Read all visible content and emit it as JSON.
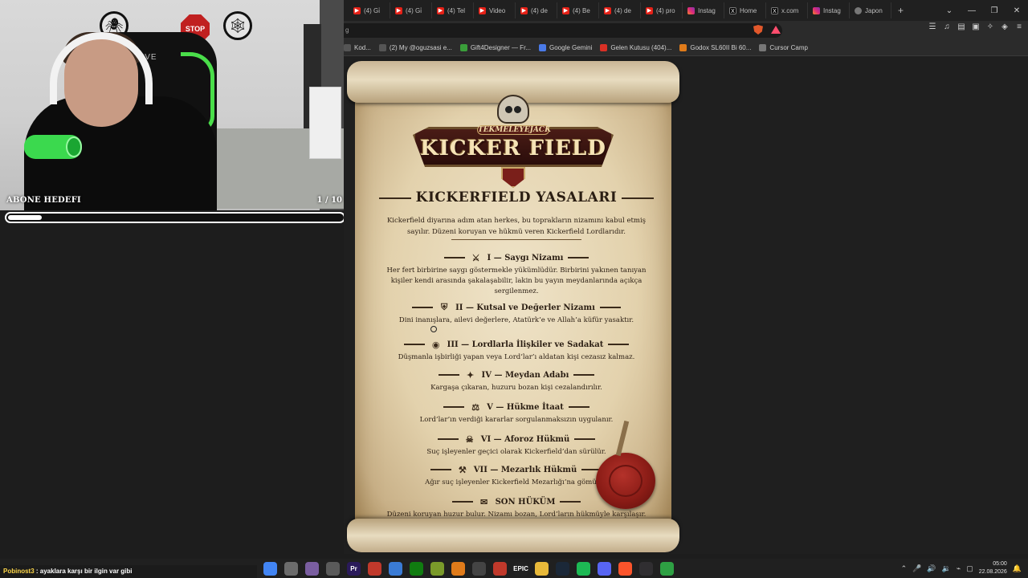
{
  "webcam": {
    "chair_brand": "DRIVE",
    "stop_sticker": "STOP",
    "goal": {
      "title": "ABONE HEDEFI",
      "count": "1 / 10",
      "progress": 0.1
    }
  },
  "browser": {
    "tabs": [
      {
        "label": "(4) Gi̇",
        "kind": "yt"
      },
      {
        "label": "(4) Gi̇",
        "kind": "yt"
      },
      {
        "label": "(4) Tel",
        "kind": "yt"
      },
      {
        "label": "Video",
        "kind": "yt"
      },
      {
        "label": "(4) de",
        "kind": "yt"
      },
      {
        "label": "(4) Be",
        "kind": "yt"
      },
      {
        "label": "(4) de",
        "kind": "yt"
      },
      {
        "label": "(4) pro",
        "kind": "yt"
      },
      {
        "label": "Instag",
        "kind": "ig"
      },
      {
        "label": "Home",
        "kind": "x"
      },
      {
        "label": "x.com",
        "kind": "x"
      },
      {
        "label": "Instag",
        "kind": "ig"
      },
      {
        "label": "Japon",
        "kind": "gray"
      }
    ],
    "new_tab": "+",
    "url": "g",
    "bookmarks": [
      {
        "label": "Kod...",
        "color": "#555"
      },
      {
        "label": "(2) My @oguzsasi e...",
        "color": "#555"
      },
      {
        "label": "Gift4Designer — Fr...",
        "color": "#3a9e3a"
      },
      {
        "label": "Google Gemini",
        "color": "#4a7ae8"
      },
      {
        "label": "Gelen Kutusu (404)...",
        "color": "#d93025"
      },
      {
        "label": "Godox SL60II Bi 60...",
        "color": "#e07b1a"
      },
      {
        "label": "Cursor Camp",
        "color": "#777"
      }
    ]
  },
  "scroll": {
    "logo_small": "TEKMELEYEJACK",
    "logo_big": "KICKER FIELD",
    "title": "KICKERFIELD YASALARI",
    "intro": "Kickerfield diyarına adım atan herkes, bu toprakların nizamını kabul etmiş sayılır. Düzeni koruyan ve hükmü veren Kickerfield Lordlarıdır.",
    "laws": [
      {
        "heading": "I — Saygı Nizamı",
        "emblem": "⚔",
        "body": "Her fert birbirine saygı göstermekle yükümlüdür. Birbirini yakınen tanıyan kişiler kendi arasında şakalaşabilir, lakin bu yayın meydanlarında açıkça sergilenmez."
      },
      {
        "heading": "II — Kutsal ve Değerler Nizamı",
        "emblem": "⛨",
        "body": "Dini inanışlara, ailevi değerlere, Atatürk’e ve Allah’a küfür yasaktır."
      },
      {
        "heading": "III — Lordlarla İlişkiler ve Sadakat",
        "emblem": "◉",
        "body": "Düşmanla işbirliği yapan veya Lord’lar’ı aldatan kişi cezasız kalmaz."
      },
      {
        "heading": "IV — Meydan Adabı",
        "emblem": "✦",
        "body": "Kargaşa çıkaran, huzuru bozan kişi cezalandırılır."
      },
      {
        "heading": "V — Hükme İtaat",
        "emblem": "⚖",
        "body": "Lord’lar’ın verdiği kararlar sorgulanmaksızın uygulanır."
      },
      {
        "heading": "VI — Aforoz Hükmü",
        "emblem": "☠",
        "body": "Suç işleyenler geçici olarak Kickerfield’dan sürülür."
      },
      {
        "heading": "VII — Mezarlık Hükmü",
        "emblem": "⚒",
        "body": "Ağır suç işleyenler Kickerfield Mezarlığı’na gömülür."
      },
      {
        "heading": "SON HÜKÜM",
        "emblem": "✉",
        "body": "Düzeni koruyan huzur bulur. Nizamı bozan, Lord’ların hükmüyle karşılaşır."
      }
    ]
  },
  "chat": {
    "user": "Pobinost3",
    "message": " : ayaklara karşı bir ilgin var gibi"
  },
  "taskbar": {
    "icons": [
      {
        "name": "chrome-icon",
        "color": "#4285f4",
        "glyph": ""
      },
      {
        "name": "notes-icon",
        "color": "#6c6c6c",
        "glyph": ""
      },
      {
        "name": "app-icon",
        "color": "#7a5ea0",
        "glyph": ""
      },
      {
        "name": "keyboard-icon",
        "color": "#5a5a5a",
        "glyph": ""
      },
      {
        "name": "premiere-icon",
        "color": "#2a1a5a",
        "glyph": "Pr"
      },
      {
        "name": "app-red-icon",
        "color": "#c0392b",
        "glyph": ""
      },
      {
        "name": "search-icon",
        "color": "#3a7bd5",
        "glyph": ""
      },
      {
        "name": "xbox-icon",
        "color": "#107c10",
        "glyph": ""
      },
      {
        "name": "ball-icon",
        "color": "#7a9a2a",
        "glyph": ""
      },
      {
        "name": "cloud-icon",
        "color": "#e07b1a",
        "glyph": ""
      },
      {
        "name": "clapper-icon",
        "color": "#444",
        "glyph": ""
      },
      {
        "name": "record-icon",
        "color": "#c0392b",
        "glyph": ""
      },
      {
        "name": "epic-icon",
        "color": "#222",
        "glyph": "EPIC"
      },
      {
        "name": "folder-icon",
        "color": "#e8b93a",
        "glyph": ""
      },
      {
        "name": "steam-icon",
        "color": "#1b2838",
        "glyph": ""
      },
      {
        "name": "spotify-icon",
        "color": "#1db954",
        "glyph": ""
      },
      {
        "name": "discord-icon",
        "color": "#5865f2",
        "glyph": ""
      },
      {
        "name": "brave-icon",
        "color": "#fb542b",
        "glyph": ""
      },
      {
        "name": "obs-icon",
        "color": "#302e31",
        "glyph": ""
      },
      {
        "name": "green-app-icon",
        "color": "#2ea043",
        "glyph": ""
      }
    ],
    "time": "05:00",
    "date": "22.08.2026"
  }
}
